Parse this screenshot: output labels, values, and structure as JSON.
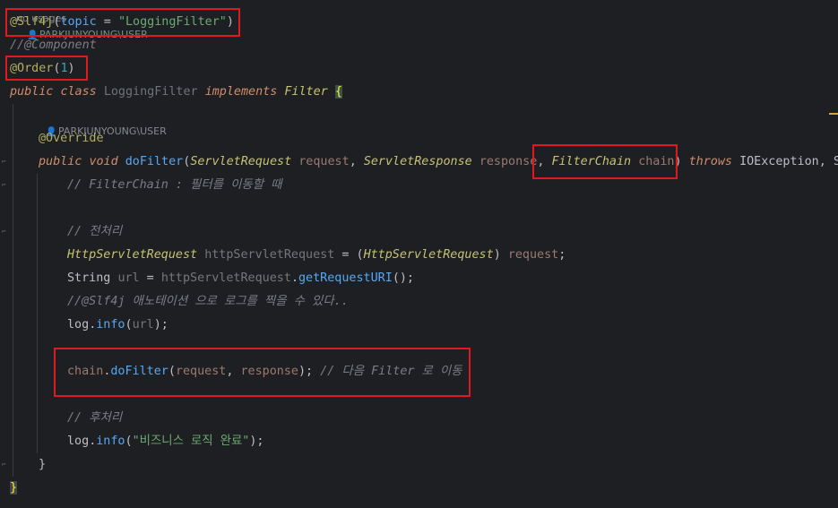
{
  "editor": {
    "usages_hint": "no usages",
    "author_hint_top": "PARKJUNYOUNG\\USER",
    "author_hint_method": "PARKJUNYOUNG\\USER",
    "line_slf4j": {
      "annotation": "@Slf4j",
      "open": "(",
      "param": "topic",
      "eq": " = ",
      "value": "\"LoggingFilter\"",
      "close": ")"
    },
    "line_component": "//@Component",
    "line_order": {
      "annotation": "@Order",
      "open": "(",
      "value": "1",
      "close": ")"
    },
    "line_class": {
      "kw_public": "public",
      "kw_class": "class",
      "name": "LoggingFilter",
      "kw_implements": "implements",
      "iface": "Filter",
      "brace": "{"
    },
    "line_override": "@Override",
    "line_method": {
      "kw_public": "public",
      "kw_void": "void",
      "name": "doFilter",
      "p1_type": "ServletRequest",
      "p1_name": "request",
      "p2_type": "ServletResponse",
      "p2_name": "response",
      "p3_type": "FilterChain",
      "p3_name": "chain",
      "kw_throws": "throws",
      "ex": "IOException",
      "rest": "Se"
    },
    "comment_filterchain": "// FilterChain : 필터를 이동할 때",
    "comment_pre": "// 전처리",
    "line_cast": {
      "type": "HttpServletRequest",
      "var": "httpServletRequest",
      "cast_type": "HttpServletRequest",
      "src": "request"
    },
    "line_url": {
      "type": "String",
      "var": "url",
      "obj": "httpServletRequest",
      "method": "getRequestURI"
    },
    "comment_slf4j": "//@Slf4j 애노테이션 으로 로그를 찍을 수 있다..",
    "line_log1": {
      "obj": "log",
      "method": "info",
      "arg": "url"
    },
    "line_chain": {
      "obj": "chain",
      "method": "doFilter",
      "a1": "request",
      "a2": "response",
      "comment": "// 다음 Filter 로 이동"
    },
    "comment_post": "// 후처리",
    "line_log2": {
      "obj": "log",
      "method": "info",
      "arg": "\"비즈니스 로직 완료\""
    },
    "close_method": "}",
    "close_class": "}"
  }
}
